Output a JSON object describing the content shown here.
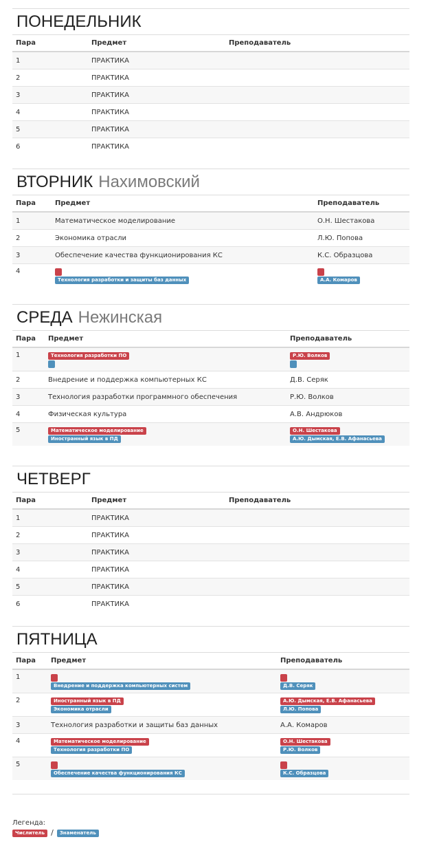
{
  "headers": {
    "para": "Пара",
    "subject": "Предмет",
    "teacher": "Преподаватель"
  },
  "monday": {
    "title": "ПОНЕДЕЛЬНИК",
    "location": "",
    "rows": [
      {
        "n": "1",
        "subject": "ПРАКТИКА"
      },
      {
        "n": "2",
        "subject": "ПРАКТИКА"
      },
      {
        "n": "3",
        "subject": "ПРАКТИКА"
      },
      {
        "n": "4",
        "subject": "ПРАКТИКА"
      },
      {
        "n": "5",
        "subject": "ПРАКТИКА"
      },
      {
        "n": "6",
        "subject": "ПРАКТИКА"
      }
    ]
  },
  "tuesday": {
    "title": "ВТОРНИК",
    "location": "Нахимовский",
    "rows": [
      {
        "n": "1",
        "subject": "Математическое моделирование",
        "teacher": "О.Н. Шестакова"
      },
      {
        "n": "2",
        "subject": "Экономика отрасли",
        "teacher": "Л.Ю. Попова"
      },
      {
        "n": "3",
        "subject": "Обеспечение качества функционирования КС",
        "teacher": "К.С. Образцова"
      },
      {
        "n": "4",
        "subject_blue": "Технология разработки и защиты баз данных",
        "teacher_blue": "А.А. Комаров"
      }
    ]
  },
  "wednesday": {
    "title": "СРЕДА",
    "location": "Нежинская",
    "rows": [
      {
        "n": "1",
        "subject_red": "Технология разработки ПО",
        "teacher_red": "Р.Ю. Волков"
      },
      {
        "n": "2",
        "subject": "Внедрение и поддержка компьютерных КС",
        "teacher": "Д.В. Серяк"
      },
      {
        "n": "3",
        "subject": "Технология разработки программного обеспечения",
        "teacher": "Р.Ю. Волков"
      },
      {
        "n": "4",
        "subject": "Физическая культура",
        "teacher": "А.В. Андрюков"
      },
      {
        "n": "5",
        "subject_red": "Математическое моделирование",
        "subject_blue": "Иностранный язык в ПД",
        "teacher_red": "О.Н. Шестакова",
        "teacher_blue": "А.Ю. Дымская, Е.В. Афанасьева"
      }
    ]
  },
  "thursday": {
    "title": "ЧЕТВЕРГ",
    "location": "",
    "rows": [
      {
        "n": "1",
        "subject": "ПРАКТИКА"
      },
      {
        "n": "2",
        "subject": "ПРАКТИКА"
      },
      {
        "n": "3",
        "subject": "ПРАКТИКА"
      },
      {
        "n": "4",
        "subject": "ПРАКТИКА"
      },
      {
        "n": "5",
        "subject": "ПРАКТИКА"
      },
      {
        "n": "6",
        "subject": "ПРАКТИКА"
      }
    ]
  },
  "friday": {
    "title": "ПЯТНИЦА",
    "location": "",
    "rows": [
      {
        "n": "1",
        "subject_blue": "Внедрение и поддержка компьютерных систем",
        "teacher_blue": "Д.В. Серяк"
      },
      {
        "n": "2",
        "subject_red": "Иностранный язык в ПД",
        "subject_blue": "Экономика отрасли",
        "teacher_red": "А.Ю. Дымская, Е.В. Афанасьева",
        "teacher_blue": "Л.Ю. Попова"
      },
      {
        "n": "3",
        "subject": "Технология разработки и защиты баз данных",
        "teacher": "А.А. Комаров"
      },
      {
        "n": "4",
        "subject_red": "Математическое моделирование",
        "subject_blue": "Технология разработки ПО",
        "teacher_red": "О.Н. Шестакова",
        "teacher_blue": "Р.Ю. Волков"
      },
      {
        "n": "5",
        "subject_blue": "Обеспечение качества функционирования КС",
        "teacher_blue": "К.С. Образцова"
      }
    ]
  },
  "legend": {
    "label": "Легенда:",
    "numerator": "Числитель",
    "separator": "/",
    "denominator": "Знаменатель"
  },
  "colors": {
    "numerator": "#c9424a",
    "denominator": "#4f90bb"
  }
}
